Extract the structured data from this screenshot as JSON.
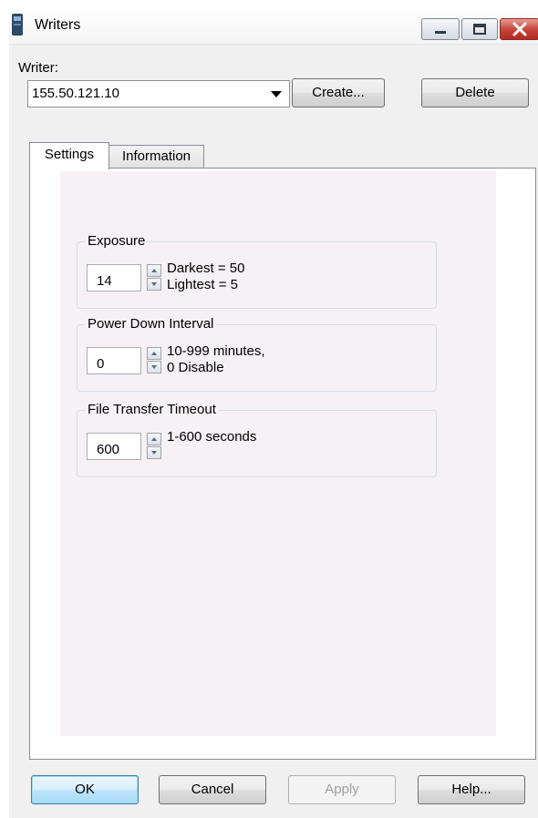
{
  "window": {
    "title": "Writers",
    "app_icon": "writer-device-icon"
  },
  "title_buttons": {
    "minimize_icon": "minimize-icon",
    "maximize_icon": "maximize-icon",
    "close_icon": "close-icon"
  },
  "writer": {
    "label": "Writer:",
    "selected": "155.50.121.10",
    "create_label": "Create...",
    "delete_label": "Delete"
  },
  "tabs": [
    {
      "label": "Settings",
      "active": true
    },
    {
      "label": "Information",
      "active": false
    }
  ],
  "settings": {
    "exposure": {
      "title": "Exposure",
      "value": "14",
      "hint_line1": "Darkest = 50",
      "hint_line2": "Lightest = 5"
    },
    "power_down": {
      "title": "Power Down Interval",
      "value": "0",
      "hint_line1": "10-999 minutes,",
      "hint_line2": "0 Disable"
    },
    "file_transfer": {
      "title": "File Transfer Timeout",
      "value": "600",
      "hint_line1": "1-600 seconds"
    }
  },
  "footer": {
    "ok_label": "OK",
    "cancel_label": "Cancel",
    "apply_label": "Apply",
    "help_label": "Help..."
  },
  "colors": {
    "close_button": "#c5423a",
    "default_button_border": "#3c7fb1",
    "page_background": "#f5f1f4"
  }
}
